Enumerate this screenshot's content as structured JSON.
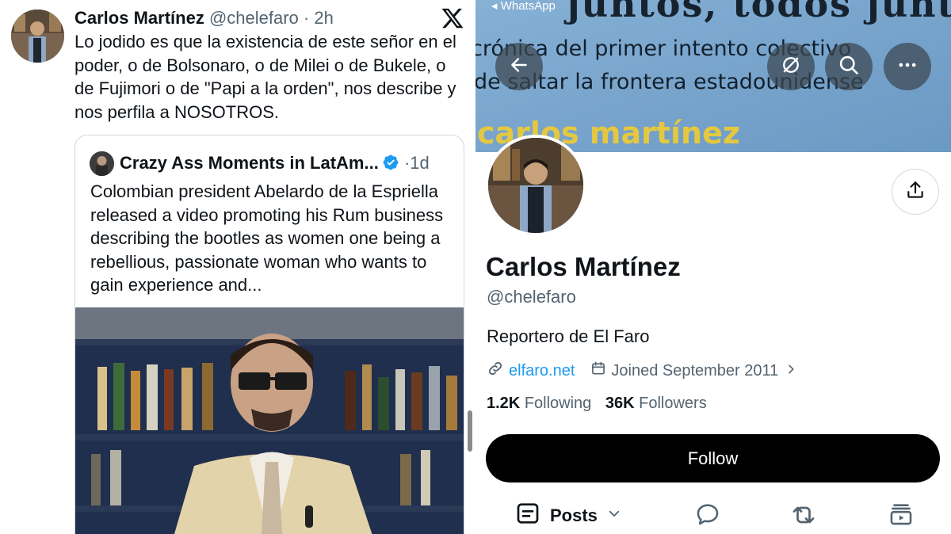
{
  "tweet": {
    "author_name": "Carlos Martínez",
    "author_handle": "@chelefaro",
    "separator": "·",
    "time": "2h",
    "text": "Lo jodido es que la existencia de este señor en el poder, o de Bolsonaro, o de Milei o de Bukele, o de Fujimori o de \"Papi a la orden\", nos describe y nos perfila a NOSOTROS.",
    "logo_icon": "x-logo-icon"
  },
  "quote": {
    "author_name": "Crazy Ass Moments in LatAm...",
    "separator": "·",
    "time": "1d",
    "verified": true,
    "text": "Colombian president Abelardo de la Espriella released a video promoting his Rum business describing the bootles as women one being a rebellious, passionate woman who wants to gain experience and..."
  },
  "profile": {
    "status_app": "WhatsApp",
    "banner_text_lines": [
      "juntos, todos juntos",
      "crónica del primer intento colectivo",
      "de saltar la frontera estadounidense",
      "carlos martínez"
    ],
    "name": "Carlos Martínez",
    "handle": "@chelefaro",
    "bio": "Reportero de El Faro",
    "website": "elfaro.net",
    "joined": "Joined September 2011",
    "following_count": "1.2K",
    "following_label": "Following",
    "followers_count": "36K",
    "followers_label": "Followers",
    "follow_button": "Follow",
    "tab_posts": "Posts"
  },
  "colors": {
    "link": "#1d9bf0",
    "secondary_text": "#536471",
    "primary_text": "#0f1419",
    "follow_bg": "#000000",
    "verified_badge": "#1d9bf0"
  }
}
